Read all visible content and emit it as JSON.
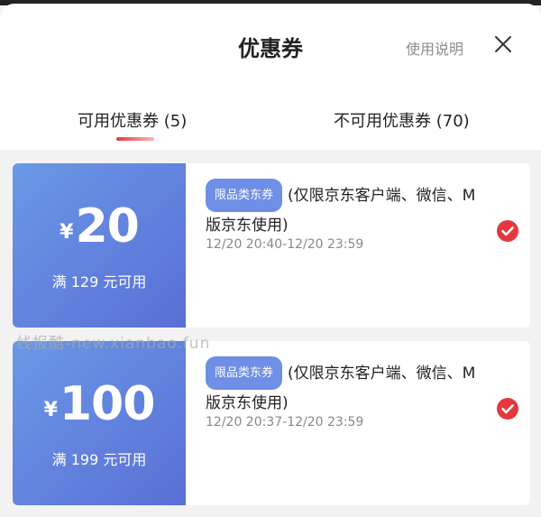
{
  "header": {
    "title": "优惠券",
    "help_link": "使用说明",
    "close_icon": "close-icon"
  },
  "tabs": [
    {
      "label": "可用优惠券 (5)",
      "active": true
    },
    {
      "label": "不可用优惠券 (70)",
      "active": false
    }
  ],
  "coupons": [
    {
      "currency": "¥",
      "amount": "20",
      "condition": "满 129 元可用",
      "tag": "限品类东券",
      "description": "(仅限京东客户端、微信、M版京东使用)",
      "time_range": "12/20 20:40-12/20 23:59",
      "selected": true
    },
    {
      "currency": "¥",
      "amount": "100",
      "condition": "满 199 元可用",
      "tag": "限品类东券",
      "description": "(仅限京东客户端、微信、M版京东使用)",
      "time_range": "12/20 20:37-12/20 23:59",
      "selected": true
    }
  ],
  "watermark": "线报酷-new.xianbao.fun",
  "colors": {
    "accent_red": "#e4393c",
    "coupon_gradient_start": "#6a98e6",
    "coupon_gradient_end": "#5a6fd6",
    "tag_bg": "#6f8fe6"
  }
}
